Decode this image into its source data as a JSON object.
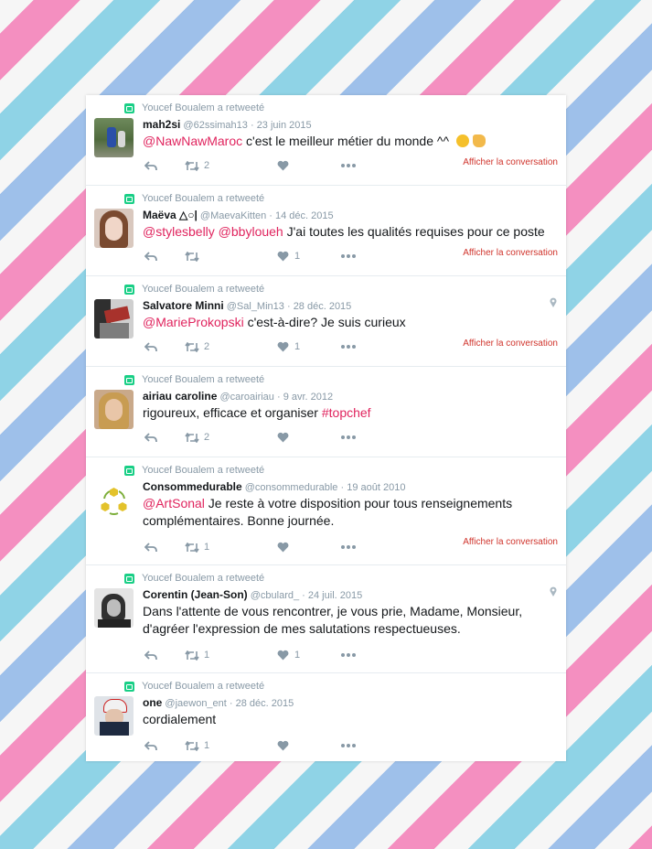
{
  "retweet_label": "Youcef Boualem a retweeté",
  "conversation_label": "Afficher la conversation",
  "accent_color": "#e0245e",
  "tweets": [
    {
      "name": "mah2si",
      "handle": "@62ssimah13",
      "date": "23 juin 2015",
      "mention": "@NawNawMaroc",
      "text": " c'est le meilleur métier du monde ^^ ",
      "hashtag": "",
      "retweets": "2",
      "likes": "",
      "location_icon": false,
      "conversation": true
    },
    {
      "name": "Maëva △○|",
      "handle": "@MaevaKitten",
      "date": "14 déc. 2015",
      "mention": "@stylesbelly @bbyloueh",
      "text": " J'ai toutes les qualités requises pour ce poste",
      "hashtag": "",
      "retweets": "",
      "likes": "1",
      "location_icon": false,
      "conversation": true
    },
    {
      "name": "Salvatore Minni",
      "handle": "@Sal_Min13",
      "date": "28 déc. 2015",
      "mention": "@MarieProkopski",
      "text": " c'est-à-dire? Je suis curieux",
      "hashtag": "",
      "retweets": "2",
      "likes": "1",
      "location_icon": true,
      "conversation": true
    },
    {
      "name": "airiau caroline",
      "handle": "@caroairiau",
      "date": "9 avr. 2012",
      "mention": "",
      "text": "rigoureux, efficace et organiser ",
      "hashtag": "#topchef",
      "retweets": "2",
      "likes": "",
      "location_icon": false,
      "conversation": false
    },
    {
      "name": "Consommedurable",
      "handle": "@consommedurable",
      "date": "19 août 2010",
      "mention": "@ArtSonal",
      "text": " Je reste à votre disposition pour tous renseignements complémentaires. Bonne journée.",
      "hashtag": "",
      "retweets": "1",
      "likes": "",
      "location_icon": false,
      "conversation": true
    },
    {
      "name": "Corentin (Jean-Son)",
      "handle": "@cbulard_",
      "date": "24 juil. 2015",
      "mention": "",
      "text": "Dans l'attente de vous rencontrer, je vous prie, Madame, Monsieur, d'agréer l'expression de mes salutations respectueuses.",
      "hashtag": "",
      "retweets": "1",
      "likes": "1",
      "location_icon": true,
      "conversation": false
    },
    {
      "name": "one",
      "handle": "@jaewon_ent",
      "date": "28 déc. 2015",
      "mention": "",
      "text": "cordialement",
      "hashtag": "",
      "retweets": "1",
      "likes": "",
      "location_icon": false,
      "conversation": false
    }
  ]
}
